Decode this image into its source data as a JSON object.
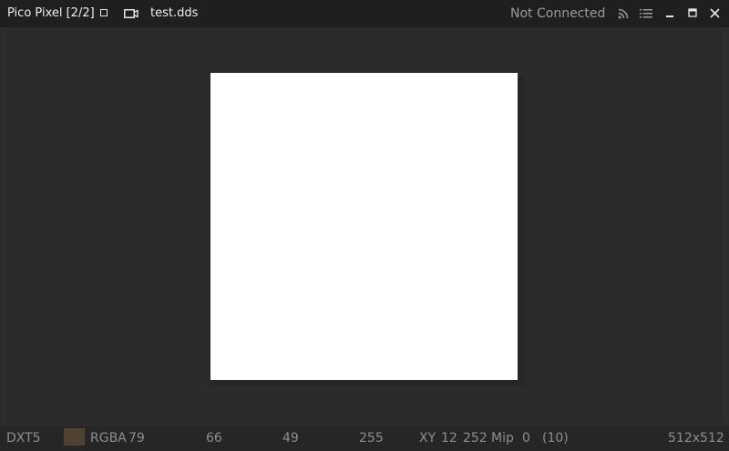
{
  "titlebar": {
    "app_title": "Pico Pixel [2/2]",
    "file_name": "test.dds",
    "connection_status": "Not Connected",
    "icons": [
      "square-icon",
      "camera-icon",
      "rss-icon",
      "list-icon",
      "minimize-icon",
      "maximize-icon",
      "close-icon"
    ]
  },
  "canvas": {
    "image_color": "#ffffff"
  },
  "statusbar": {
    "format": "DXT5",
    "swatch_color": "#4f4231",
    "channel_label": "RGBA",
    "r": "79",
    "g": "66",
    "b": "49",
    "a": "255",
    "xy_label": "XY",
    "x": "12",
    "y": "252",
    "mip_label": "Mip",
    "mip": "0",
    "mip_count": "(10)",
    "dimensions": "512x512"
  }
}
